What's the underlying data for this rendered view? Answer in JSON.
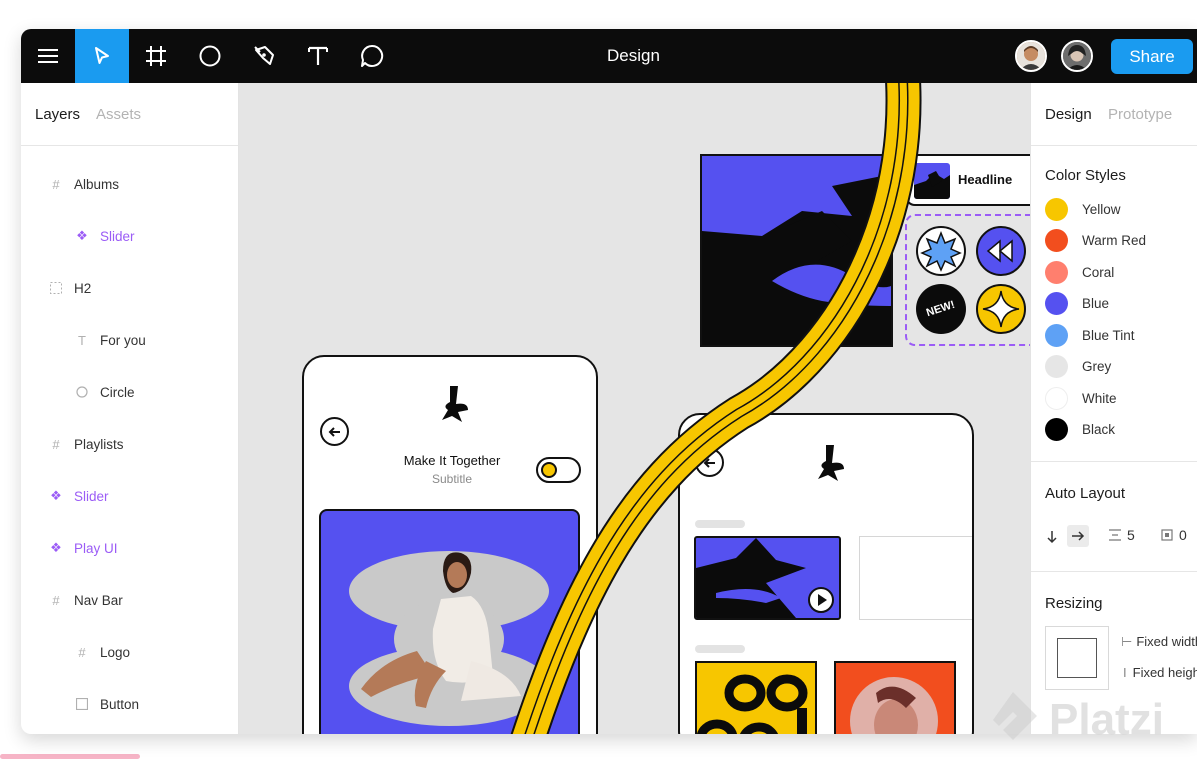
{
  "toolbar": {
    "title": "Design",
    "share_label": "Share",
    "tools": [
      "menu-icon",
      "cursor-icon",
      "frame-icon",
      "ellipse-icon",
      "pen-icon",
      "text-icon",
      "comment-icon"
    ]
  },
  "left_panel": {
    "tabs": [
      "Layers",
      "Assets"
    ],
    "layers": [
      {
        "label": "Albums",
        "icon": "frame-icon"
      },
      {
        "label": "Slider",
        "icon": "component-icon"
      },
      {
        "label": "H2",
        "icon": "group-icon"
      },
      {
        "label": "For you",
        "icon": "text-icon"
      },
      {
        "label": "Circle",
        "icon": "circle-icon"
      },
      {
        "label": "Playlists",
        "icon": "frame-icon"
      },
      {
        "label": "Slider",
        "icon": "component-icon"
      },
      {
        "label": "Play UI",
        "icon": "component-icon"
      },
      {
        "label": "Nav Bar",
        "icon": "frame-icon"
      },
      {
        "label": "Logo",
        "icon": "frame-icon"
      },
      {
        "label": "Button",
        "icon": "rectangle-icon"
      }
    ]
  },
  "right_panel": {
    "tabs": [
      "Design",
      "Prototype"
    ],
    "color_styles_title": "Color Styles",
    "colors": [
      {
        "name": "Yellow",
        "hex": "#f7c600"
      },
      {
        "name": "Warm Red",
        "hex": "#f24e1e"
      },
      {
        "name": "Coral",
        "hex": "#ff7f6e"
      },
      {
        "name": "Blue",
        "hex": "#5551f0"
      },
      {
        "name": "Blue Tint",
        "hex": "#5ea1f5"
      },
      {
        "name": "Grey",
        "hex": "#e6e6e6"
      },
      {
        "name": "White",
        "hex": "#ffffff"
      },
      {
        "name": "Black",
        "hex": "#000000"
      }
    ],
    "auto_layout_title": "Auto Layout",
    "auto_layout_spacing": "5",
    "auto_layout_padding": "0",
    "resizing_title": "Resizing",
    "fixed_width": "Fixed width",
    "fixed_height": "Fixed height"
  },
  "canvas": {
    "headline_label": "Headline",
    "new_badge": "NEW!",
    "phone1_title": "Make It Together",
    "phone1_subtitle": "Subtitle"
  },
  "watermark": "Platzi"
}
